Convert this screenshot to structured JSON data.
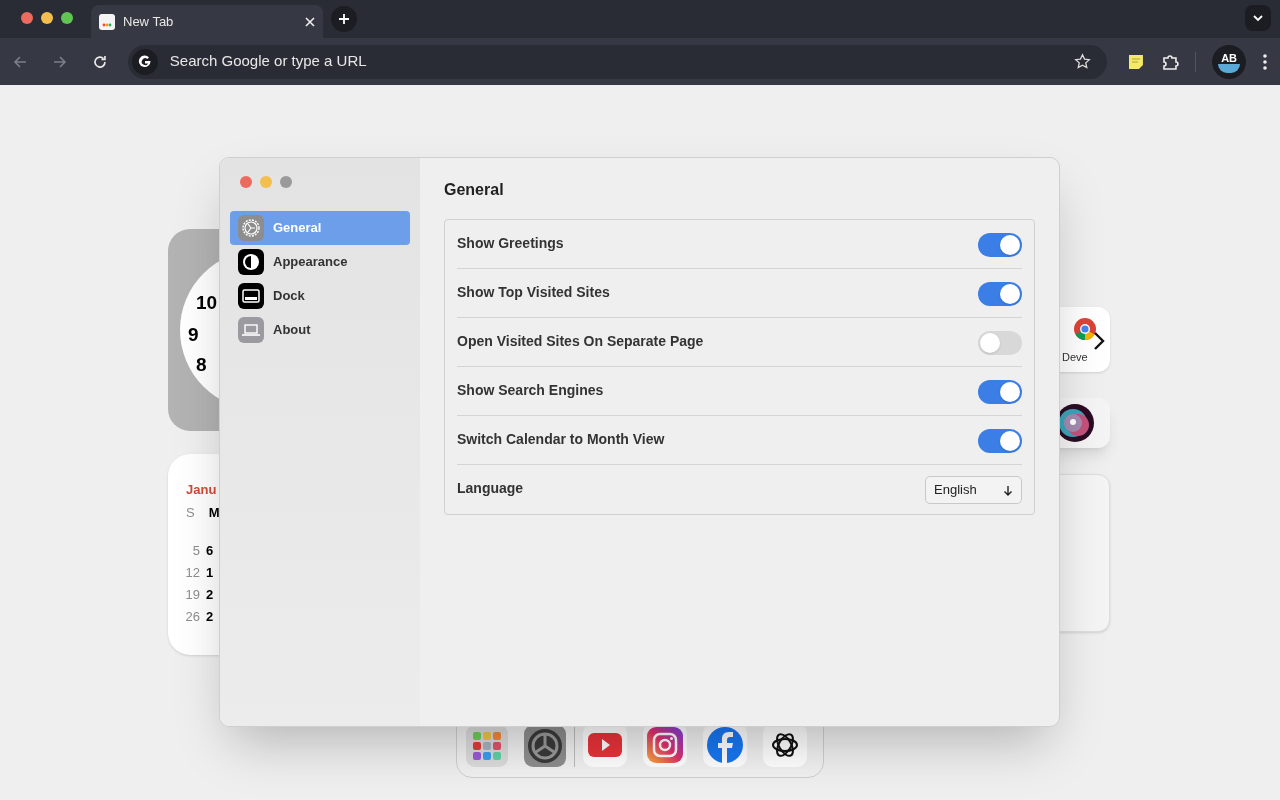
{
  "browser": {
    "tab": {
      "title": "New Tab",
      "selected": true
    },
    "address": {
      "placeholder": "Search Google or type a URL"
    },
    "profile": "AB"
  },
  "background": {
    "clock_numerals": [
      "10",
      "9",
      "8"
    ],
    "calendar": {
      "month": "Janu",
      "weekdays": [
        "S",
        "M"
      ],
      "weeks": [
        [
          "5",
          "6"
        ],
        [
          "12",
          "1"
        ],
        [
          "19",
          "2"
        ],
        [
          "26",
          "2"
        ]
      ]
    },
    "shortcut_label": "Deve"
  },
  "settings": {
    "sidebar": [
      {
        "label": "General",
        "kind": "gear",
        "selected": true
      },
      {
        "label": "Appearance",
        "kind": "appearance",
        "selected": false
      },
      {
        "label": "Dock",
        "kind": "dock",
        "selected": false
      },
      {
        "label": "About",
        "kind": "laptop",
        "selected": false
      }
    ],
    "title": "General",
    "rows": [
      {
        "kind": "toggle",
        "label": "Show Greetings",
        "on": true
      },
      {
        "kind": "toggle",
        "label": "Show Top Visited Sites",
        "on": true
      },
      {
        "kind": "toggle",
        "label": "Open Visited Sites On Separate Page",
        "on": false
      },
      {
        "kind": "toggle",
        "label": "Show Search Engines",
        "on": true
      },
      {
        "kind": "toggle",
        "label": "Switch Calendar to Month View",
        "on": true
      },
      {
        "kind": "select",
        "label": "Language",
        "value": "English"
      }
    ]
  }
}
